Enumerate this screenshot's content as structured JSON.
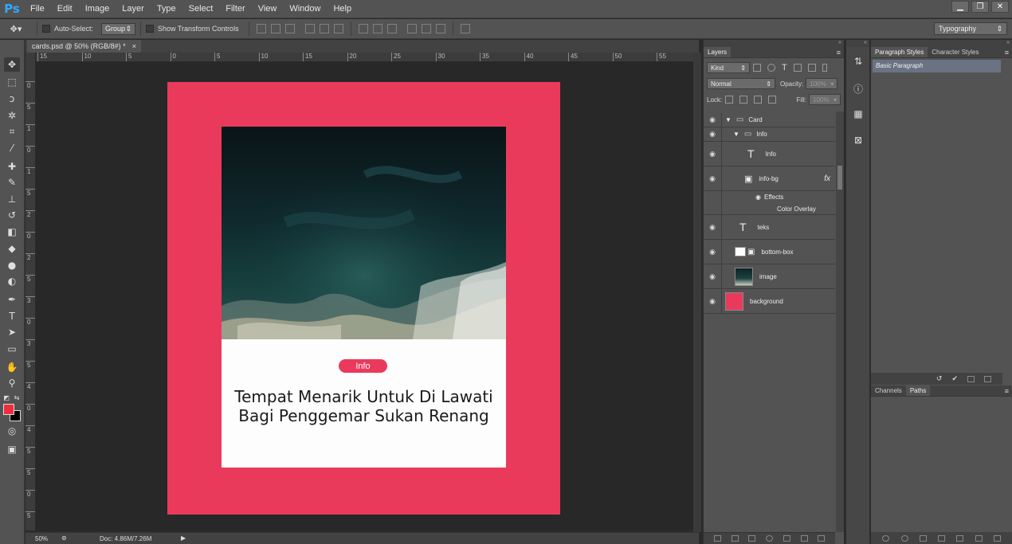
{
  "app": {
    "logo": "Ps",
    "menu": [
      "File",
      "Edit",
      "Image",
      "Layer",
      "Type",
      "Select",
      "Filter",
      "View",
      "Window",
      "Help"
    ],
    "window_controls": [
      "minimize-icon",
      "restore-icon",
      "close-icon"
    ]
  },
  "options_bar": {
    "auto_select_label": "Auto-Select:",
    "auto_select_value": "Group",
    "transform_label": "Show Transform Controls",
    "workspace": "Typography"
  },
  "document": {
    "tab_title": "cards.psd @ 50% (RGB/8#) *",
    "close": "×",
    "zoom": "50%",
    "doc_size": "Doc: 4.86M/7.26M"
  },
  "ruler": {
    "top_ticks": [
      "15",
      "10",
      "5",
      "0",
      "5",
      "10",
      "15",
      "20",
      "25",
      "30",
      "35",
      "40",
      "45",
      "50",
      "55"
    ],
    "left_ticks": [
      "0",
      "5",
      "1",
      "0",
      "1",
      "5",
      "2",
      "0",
      "2",
      "5",
      "3",
      "0",
      "3",
      "5",
      "4",
      "0",
      "4",
      "5",
      "5",
      "0",
      "5",
      "5"
    ]
  },
  "canvas": {
    "artboard_color": "#ea3a5c",
    "card": {
      "badge": "Info",
      "title": "Tempat Menarik Untuk Di Lawati Bagi Penggemar Sukan Renang"
    }
  },
  "layers_panel": {
    "tab": "Layers",
    "kind_label": "Kind",
    "blend_mode": "Normal",
    "opacity_label": "Opacity:",
    "opacity_value": "100%",
    "lock_label": "Lock:",
    "fill_label": "Fill:",
    "fill_value": "100%",
    "layers": [
      {
        "name": "Card",
        "type": "group"
      },
      {
        "name": "Info",
        "type": "group"
      },
      {
        "name": "Info",
        "type": "text"
      },
      {
        "name": "info-bg",
        "type": "shape",
        "fx": "fx"
      },
      {
        "name": "Effects",
        "type": "effects"
      },
      {
        "name": "Color Overlay",
        "type": "effect"
      },
      {
        "name": "teks",
        "type": "text"
      },
      {
        "name": "bottom-box",
        "type": "shape"
      },
      {
        "name": "image",
        "type": "image"
      },
      {
        "name": "background",
        "type": "fill"
      }
    ]
  },
  "right_panels": {
    "tabs": [
      "Paragraph Styles",
      "Character Styles"
    ],
    "selected_style": "Basic Paragraph",
    "bottom_tabs": [
      "Channels",
      "Paths"
    ]
  }
}
